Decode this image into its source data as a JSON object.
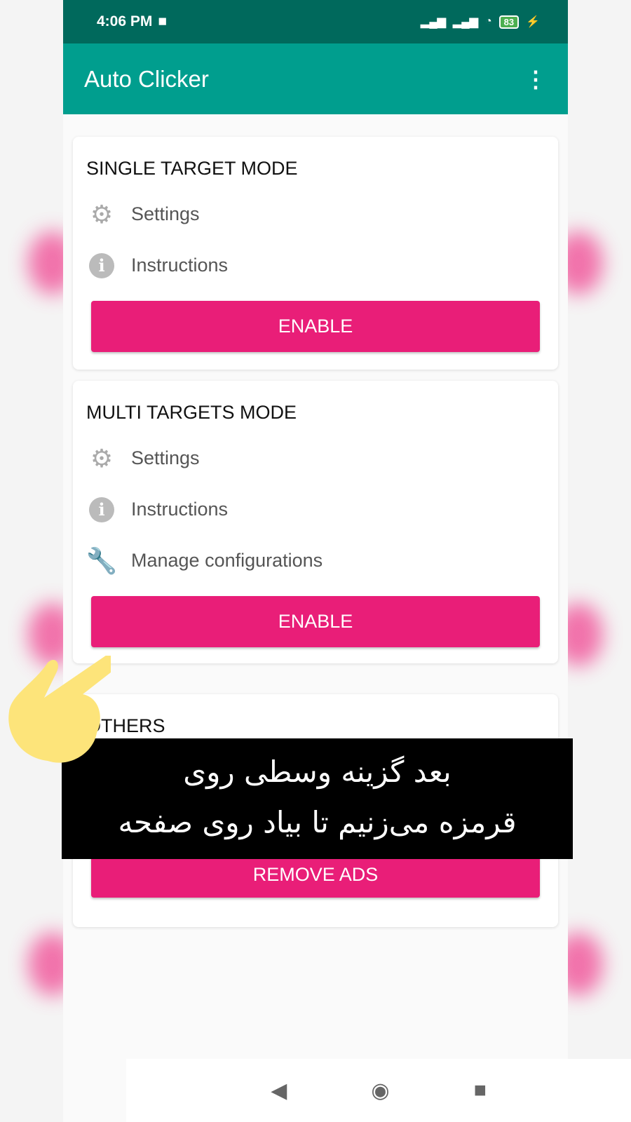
{
  "status_bar": {
    "time": "4:06 PM",
    "battery": "83"
  },
  "app_bar": {
    "title": "Auto Clicker",
    "menu_icon": "more-vert-icon"
  },
  "cards": [
    {
      "title": "SINGLE TARGET MODE",
      "items": [
        {
          "icon": "gear-icon",
          "label": "Settings"
        },
        {
          "icon": "info-icon",
          "label": "Instructions"
        }
      ],
      "button": "ENABLE"
    },
    {
      "title": "MULTI TARGETS MODE",
      "items": [
        {
          "icon": "gear-icon",
          "label": "Settings"
        },
        {
          "icon": "info-icon",
          "label": "Instructions"
        },
        {
          "icon": "wrench-icon",
          "label": "Manage configurations"
        }
      ],
      "button": "ENABLE"
    },
    {
      "title": "OTHERS",
      "button": "REMOVE ADS"
    }
  ],
  "caption": {
    "line1": "بعد گزینه وسطی روی",
    "line2": "قرمزه می‌زنیم تا بیاد روی صفحه"
  },
  "colors": {
    "status_bar": "#00695c",
    "app_bar": "#009e8e",
    "accent": "#e91e78"
  }
}
